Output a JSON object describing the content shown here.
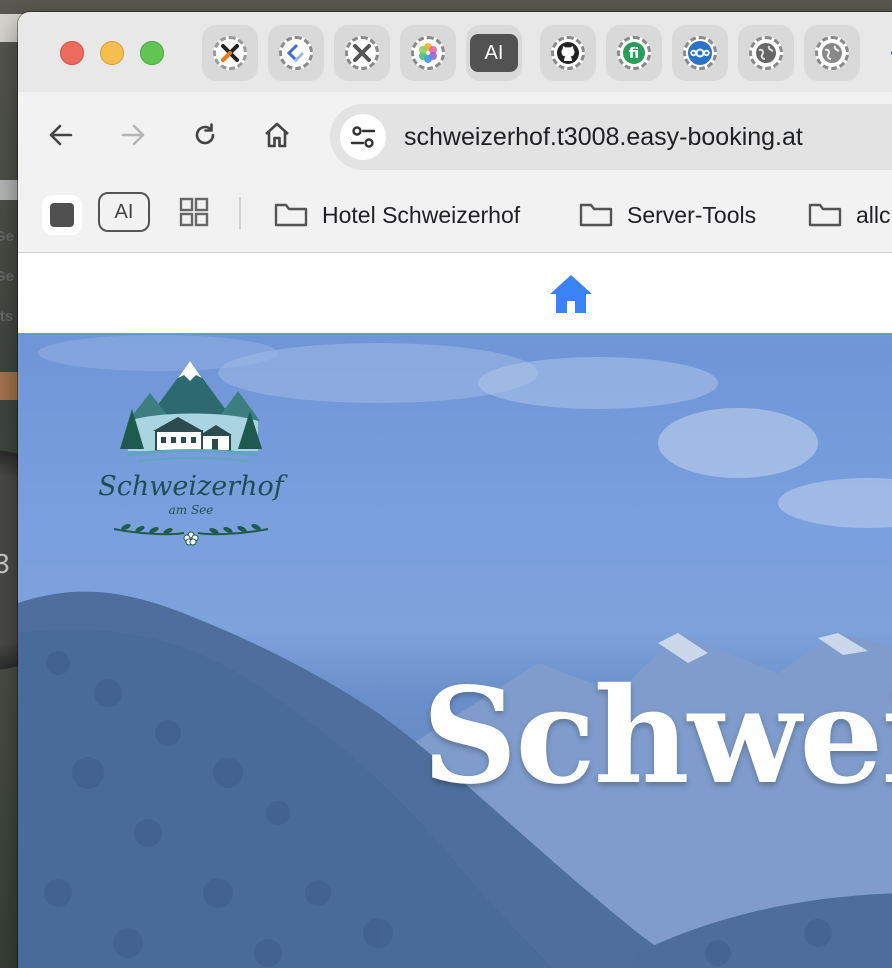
{
  "desktop": {
    "labels": [
      "Ge",
      "Ge",
      "rts"
    ],
    "gauge_number": "3"
  },
  "browser": {
    "pinned_tabs": [
      {
        "icon": "x-orange-icon",
        "color": "#f07a1a"
      },
      {
        "icon": "code-brackets-icon",
        "color": "#3d6fd8"
      },
      {
        "icon": "x-gray-icon",
        "color": "#555555"
      },
      {
        "icon": "photos-pinwheel-icon",
        "color": "#e85a9b"
      },
      {
        "icon": "ai-icon",
        "label": "AI"
      },
      {
        "icon": "github-icon",
        "color": "#222222"
      },
      {
        "icon": "fi-icon",
        "color": "#2a9d5b"
      },
      {
        "icon": "nextcloud-icon",
        "color": "#2a73c8"
      },
      {
        "icon": "globe-icon",
        "color": "#666666"
      },
      {
        "icon": "globe-icon",
        "color": "#888888"
      }
    ],
    "toolbar": {
      "back_icon": "arrow-left-icon",
      "forward_icon": "arrow-right-icon",
      "reload_icon": "reload-icon",
      "home_icon": "home-outline-icon",
      "url": "schweizerhof.t3008.easy-booking.at"
    },
    "bookmarks": {
      "ai_label": "AI",
      "folders": [
        "Hotel Schweizerhof",
        "Server-Tools",
        "allc"
      ]
    }
  },
  "site": {
    "nav_icon": "home-icon",
    "accent": "#3b82f6",
    "logo": {
      "name": "Schweizerhof",
      "subtitle": "am See"
    },
    "hero_title": "Schwei"
  }
}
